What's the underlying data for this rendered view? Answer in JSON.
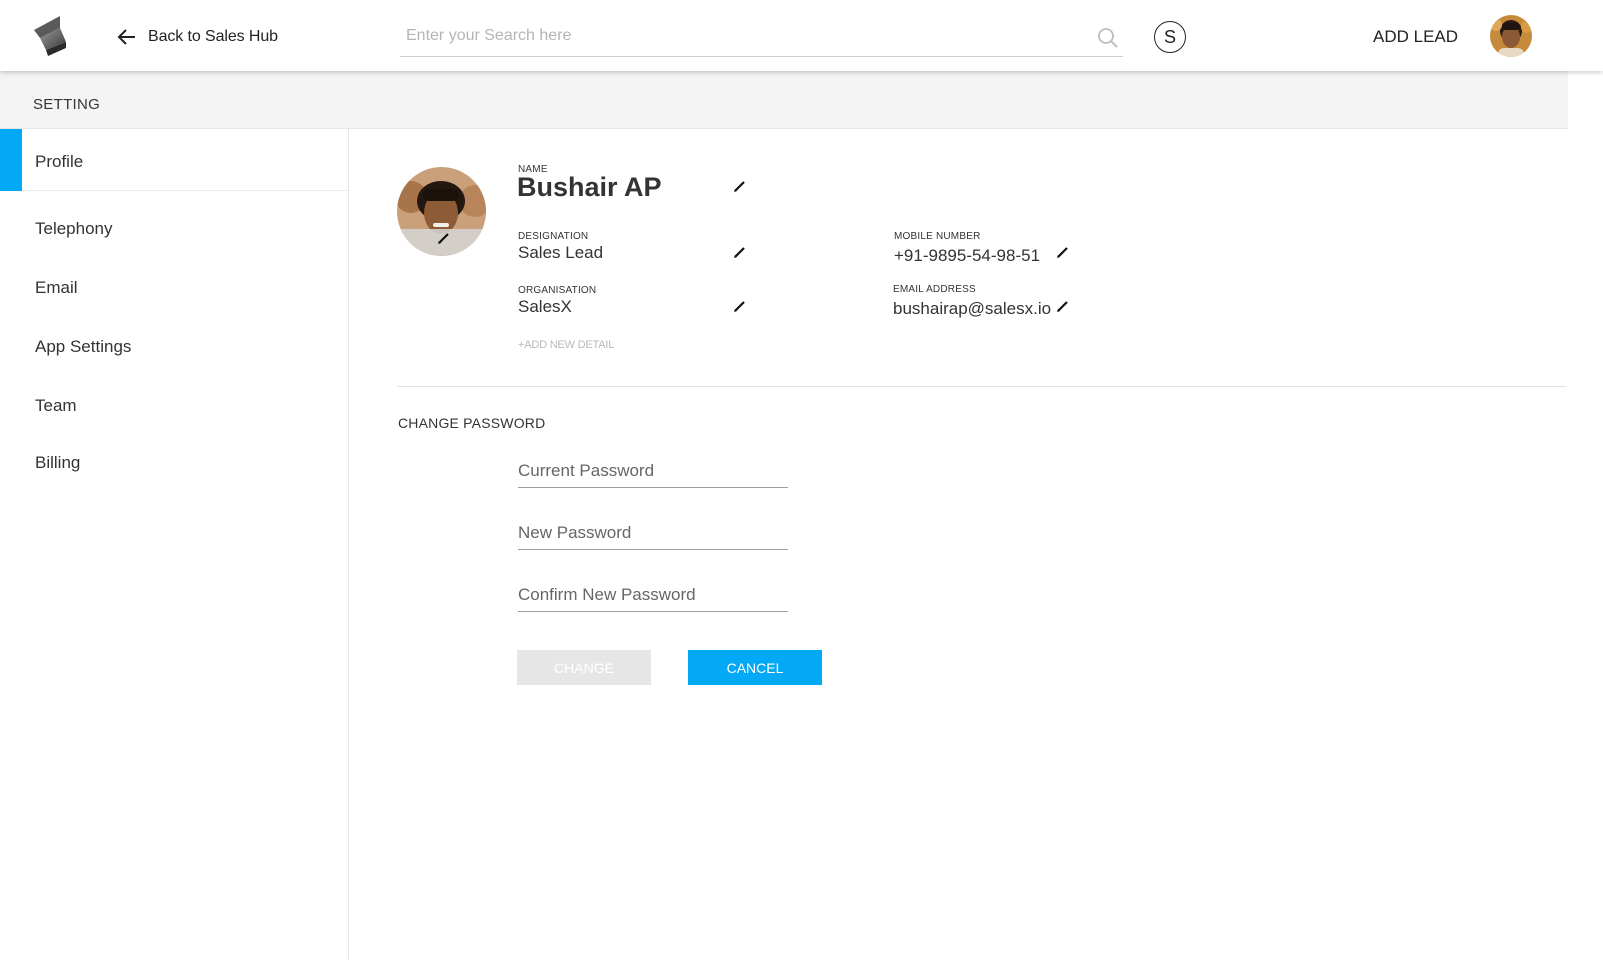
{
  "header": {
    "back_label": "Back to Sales Hub",
    "search_placeholder": "Enter your Search here",
    "s_button_label": "S",
    "add_lead_label": "ADD LEAD"
  },
  "settings": {
    "title": "SETTING"
  },
  "sidebar": {
    "items": [
      {
        "label": "Profile",
        "active": true
      },
      {
        "label": "Telephony",
        "active": false
      },
      {
        "label": "Email",
        "active": false
      },
      {
        "label": "App Settings",
        "active": false
      },
      {
        "label": "Team",
        "active": false
      },
      {
        "label": "Billing",
        "active": false
      }
    ],
    "accent_color": "#03a9f4"
  },
  "profile": {
    "name_caption": "NAME",
    "name": "Bushair AP",
    "designation_caption": "DESIGNATION",
    "designation": "Sales Lead",
    "organisation_caption": "ORGANISATION",
    "organisation": "SalesX",
    "mobile_caption": "MOBILE NUMBER",
    "mobile": "+91-9895-54-98-51",
    "email_caption": "EMAIL ADDRESS",
    "email": "bushairap@salesx.io",
    "add_detail_label": "+ADD NEW DETAIL"
  },
  "password": {
    "title": "CHANGE PASSWORD",
    "current_placeholder": "Current Password",
    "new_placeholder": "New Password",
    "confirm_placeholder": "Confirm New Password",
    "change_label": "CHANGE",
    "cancel_label": "CANCEL"
  },
  "colors": {
    "accent": "#03a9f4",
    "disabled_button": "#e6e6e6"
  },
  "icons": [
    "logo-icon",
    "arrow-left-icon",
    "search-icon",
    "edit-pencil-icon",
    "avatar"
  ]
}
